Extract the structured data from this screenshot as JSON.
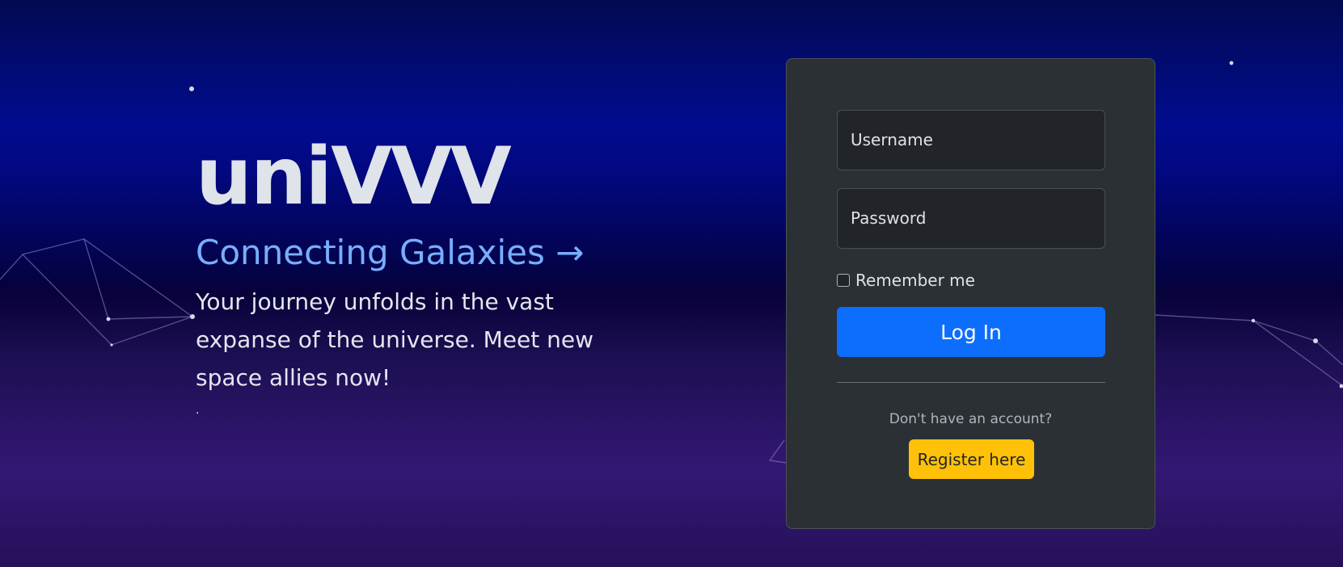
{
  "hero": {
    "brand": "uniVVV",
    "tagline": "Connecting Galaxies →",
    "intro": "Your journey unfolds in the vast expanse of the universe. Meet new space allies now!",
    "footnote": "."
  },
  "login_form": {
    "username_placeholder": "Username",
    "password_placeholder": "Password",
    "remember_label": "Remember me",
    "remember_checked": false,
    "login_label": "Log In",
    "no_account_text": "Don't have an account?",
    "register_label": "Register here"
  },
  "colors": {
    "accent_blue": "#0d6efd",
    "tagline_blue": "#78aeff",
    "register_yellow": "#ffc107",
    "card_bg": "#2b3035"
  }
}
